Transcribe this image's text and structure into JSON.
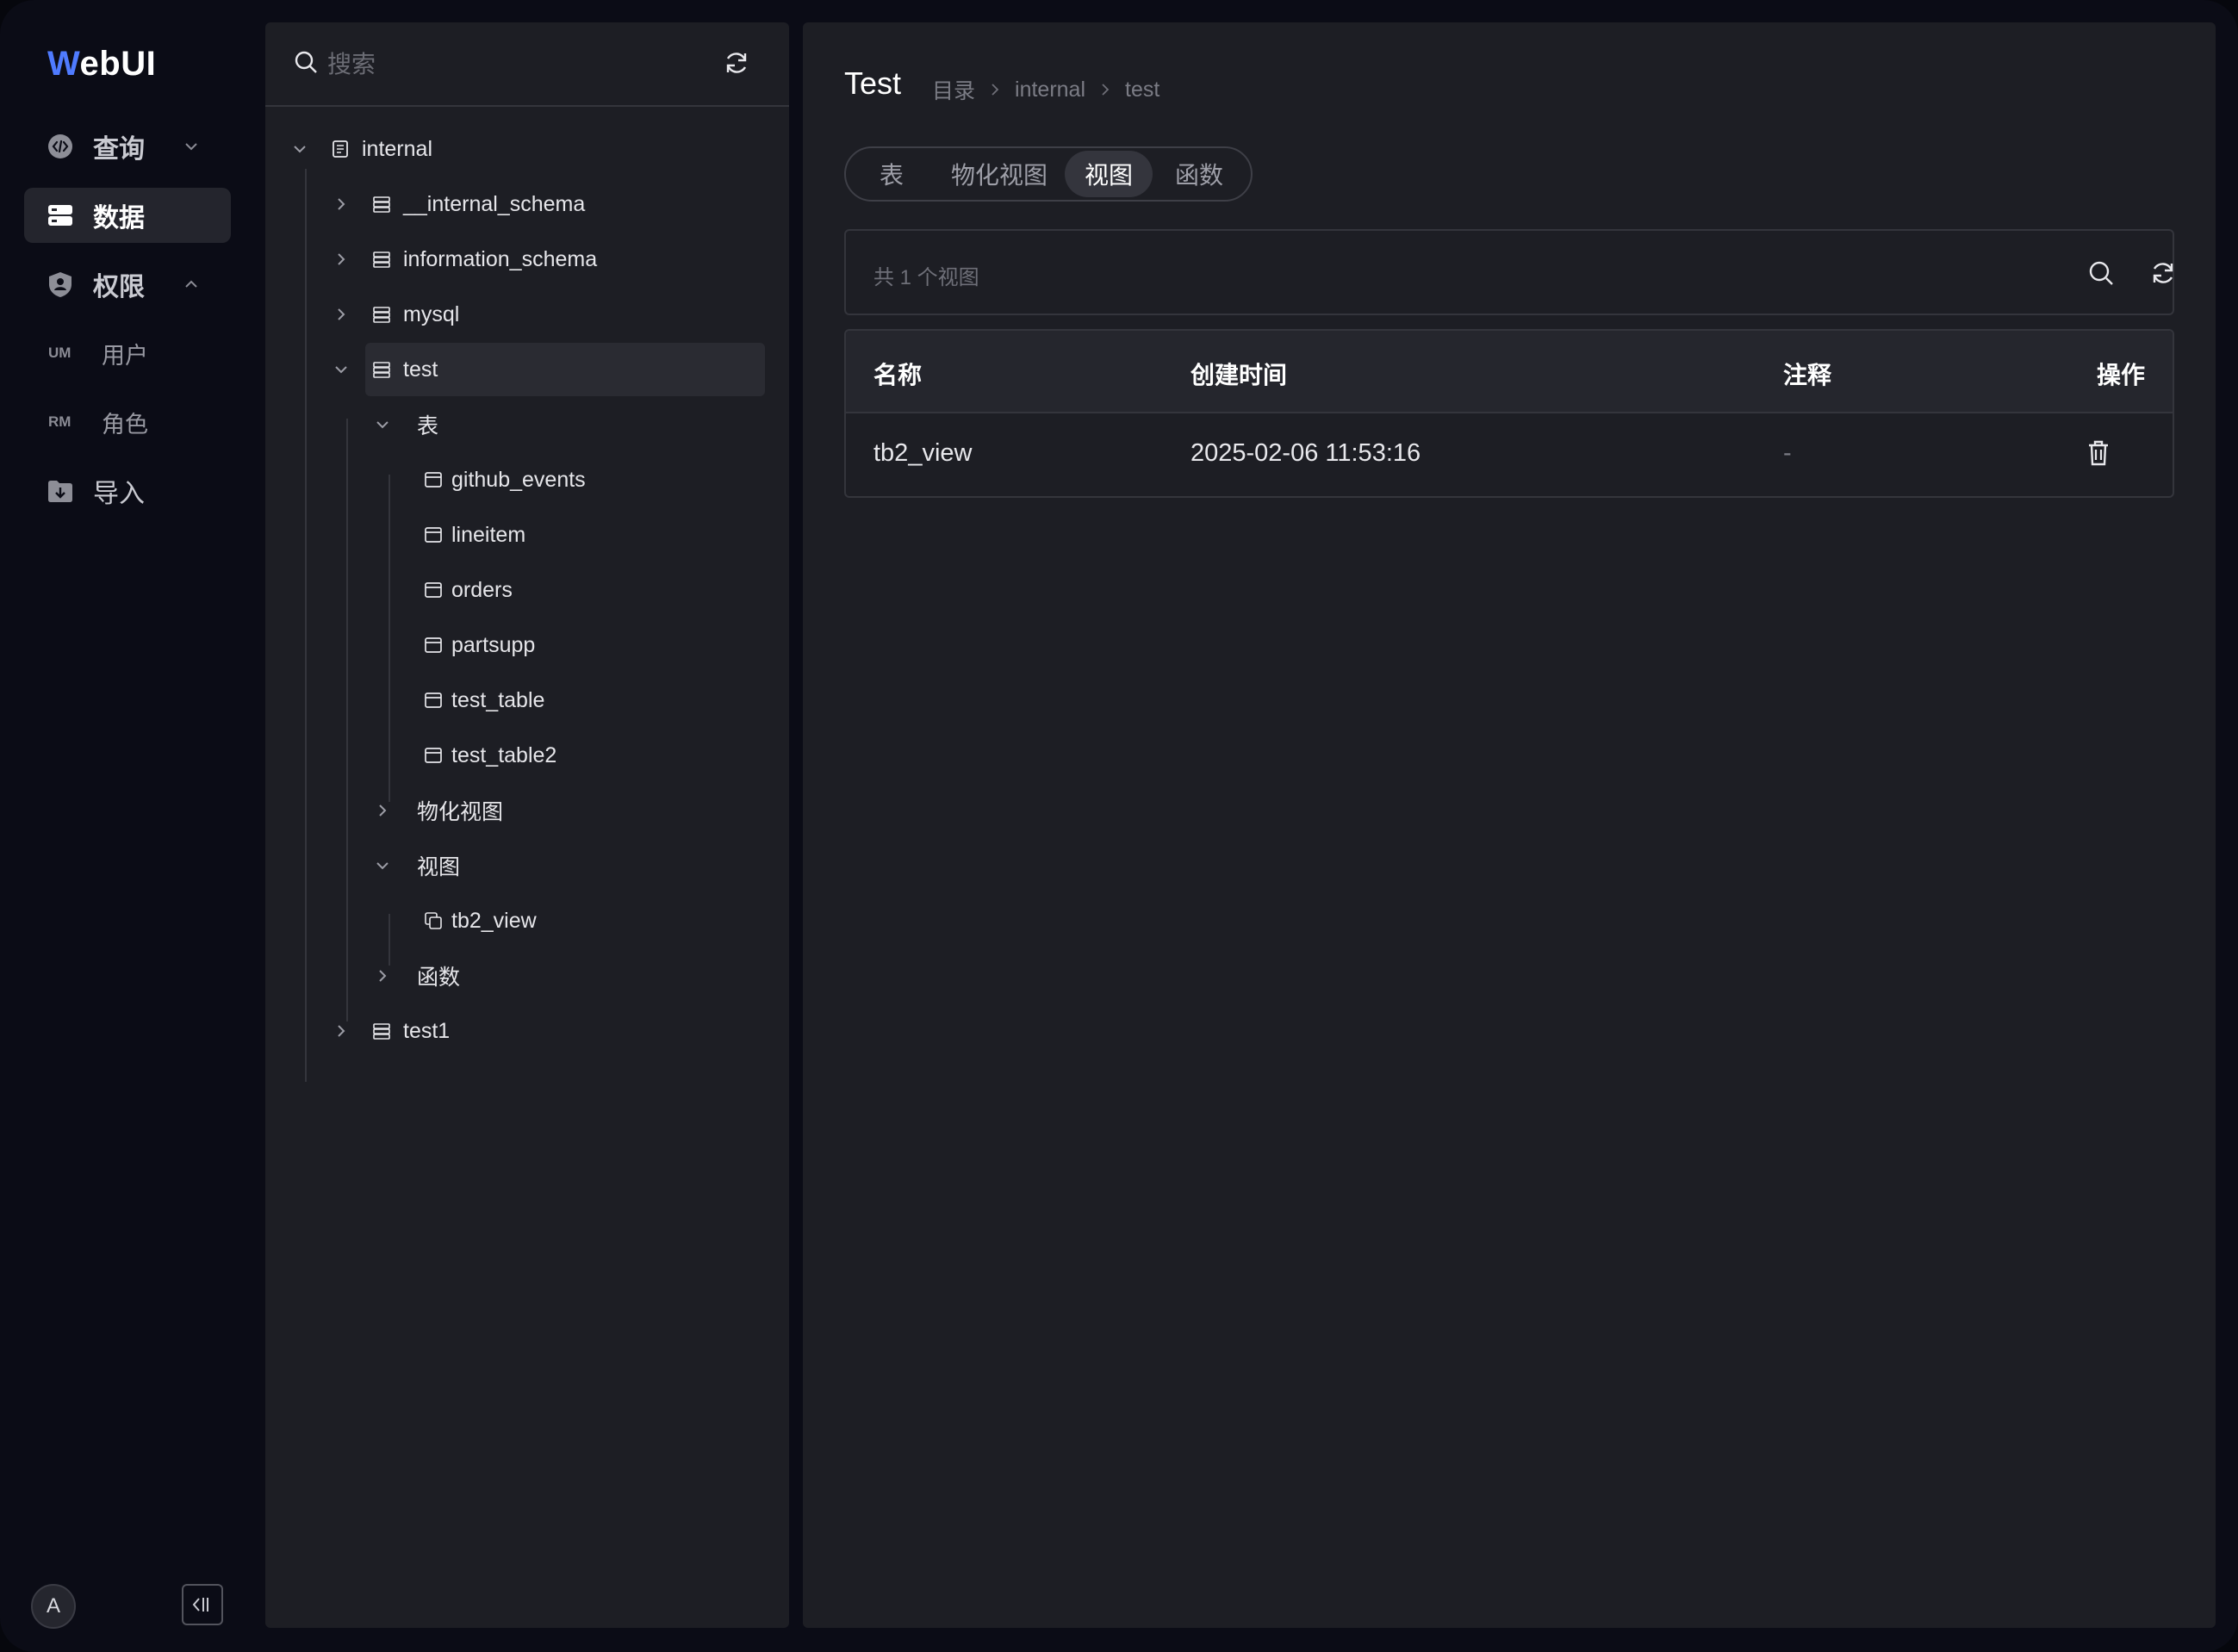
{
  "nav": {
    "logo_accent": "W",
    "logo_rest": "ebUI",
    "items": [
      {
        "label": "查询"
      },
      {
        "label": "数据"
      },
      {
        "label": "权限"
      }
    ],
    "sub_items": [
      {
        "tag": "UM",
        "label": "用户"
      },
      {
        "tag": "RM",
        "label": "角色"
      }
    ],
    "import_label": "导入",
    "avatar": "A"
  },
  "tree": {
    "search_placeholder": "搜索",
    "nodes": {
      "internal": "internal",
      "internal_schema": "__internal_schema",
      "information_schema": "information_schema",
      "mysql": "mysql",
      "test": "test",
      "tables_group": "表",
      "github_events": "github_events",
      "lineitem": "lineitem",
      "orders": "orders",
      "partsupp": "partsupp",
      "test_table": "test_table",
      "test_table2": "test_table2",
      "mv_group": "物化视图",
      "views_group": "视图",
      "tb2_view": "tb2_view",
      "functions_group": "函数",
      "test1": "test1"
    }
  },
  "main": {
    "title": "Test",
    "breadcrumb": [
      "目录",
      "internal",
      "test"
    ],
    "tabs": [
      "表",
      "物化视图",
      "视图",
      "函数"
    ],
    "active_tab": "视图",
    "count_text": "共 1 个视图",
    "table": {
      "headers": [
        "名称",
        "创建时间",
        "注释",
        "操作"
      ],
      "rows": [
        {
          "name": "tb2_view",
          "created": "2025-02-06 11:53:16",
          "comment": "-"
        }
      ]
    }
  },
  "colors": {
    "accent": "#4f7bff",
    "background": "#0b0c16",
    "panel": "#1d1e24"
  }
}
